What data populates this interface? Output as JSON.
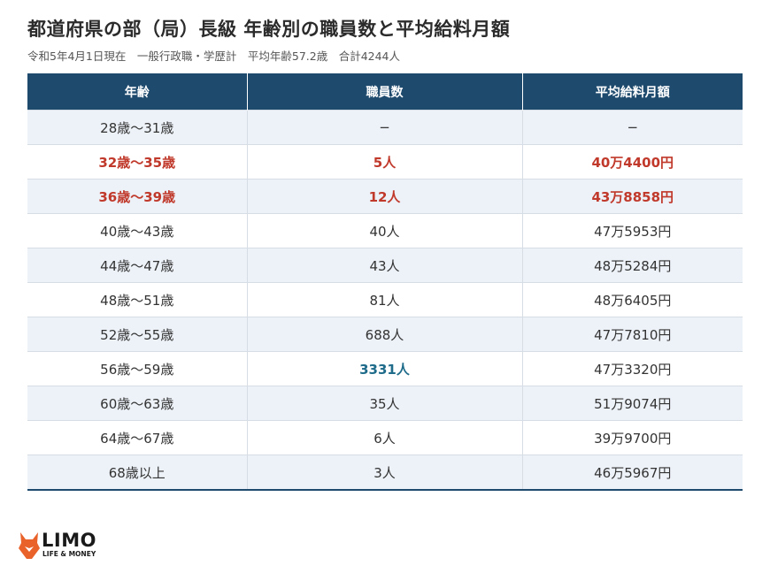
{
  "title": "都道府県の部（局）長級 年齢別の職員数と平均給料月額",
  "subtitle": "令和5年4月1日現在　一般行政職・学歴計　平均年齢57.2歳　合計4244人",
  "table": {
    "headers": [
      "年齢",
      "職員数",
      "平均給料月額"
    ],
    "rows": [
      {
        "age": "28歳〜31歳",
        "count": "−",
        "salary": "−",
        "style": ""
      },
      {
        "age": "32歳〜35歳",
        "count": "5人",
        "salary": "40万4400円",
        "style": "red"
      },
      {
        "age": "36歳〜39歳",
        "count": "12人",
        "salary": "43万8858円",
        "style": "red"
      },
      {
        "age": "40歳〜43歳",
        "count": "40人",
        "salary": "47万5953円",
        "style": ""
      },
      {
        "age": "44歳〜47歳",
        "count": "43人",
        "salary": "48万5284円",
        "style": ""
      },
      {
        "age": "48歳〜51歳",
        "count": "81人",
        "salary": "48万6405円",
        "style": ""
      },
      {
        "age": "52歳〜55歳",
        "count": "688人",
        "salary": "47万7810円",
        "style": ""
      },
      {
        "age": "56歳〜59歳",
        "count": "3331人",
        "salary": "47万3320円",
        "style": "blue-count"
      },
      {
        "age": "60歳〜63歳",
        "count": "35人",
        "salary": "51万9074円",
        "style": ""
      },
      {
        "age": "64歳〜67歳",
        "count": "6人",
        "salary": "39万9700円",
        "style": ""
      },
      {
        "age": "68歳以上",
        "count": "3人",
        "salary": "46万5967円",
        "style": ""
      }
    ]
  },
  "colors": {
    "header_bg": "#1e4a6e",
    "highlight_red": "#c0392b",
    "highlight_blue": "#1e6b8a",
    "logo_orange": "#e8622a"
  },
  "logo": {
    "name": "LIMO",
    "tagline": "LIFE & MONEY",
    "icon": "fox-icon"
  }
}
